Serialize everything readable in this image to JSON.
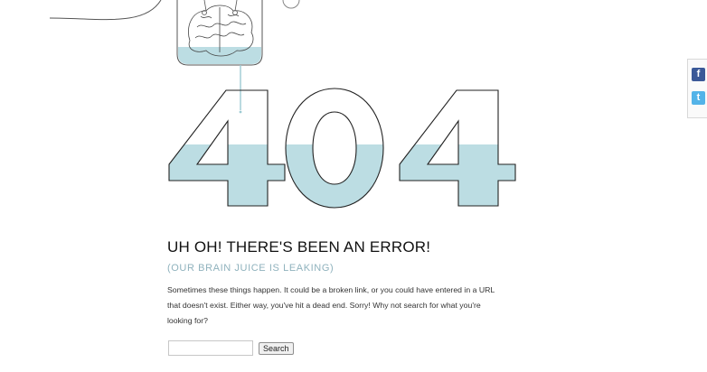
{
  "error": {
    "code": "404",
    "headline": "UH OH! THERE'S BEEN AN ERROR!",
    "subhead": "(OUR BRAIN JUICE IS LEAKING)",
    "message": "Sometimes these things happen. It could be a broken link, or you could have entered in a URL that doesn't exist. Either way, you've hit a dead end. Sorry! Why not search for what you're looking for?"
  },
  "search": {
    "value": "",
    "placeholder": "",
    "button_label": "Search"
  },
  "social": {
    "facebook_icon": "facebook-icon",
    "twitter_icon": "twitter-icon"
  },
  "colors": {
    "liquid": "#bcdde3",
    "outline": "#222222",
    "accent": "#8fb2bd"
  }
}
